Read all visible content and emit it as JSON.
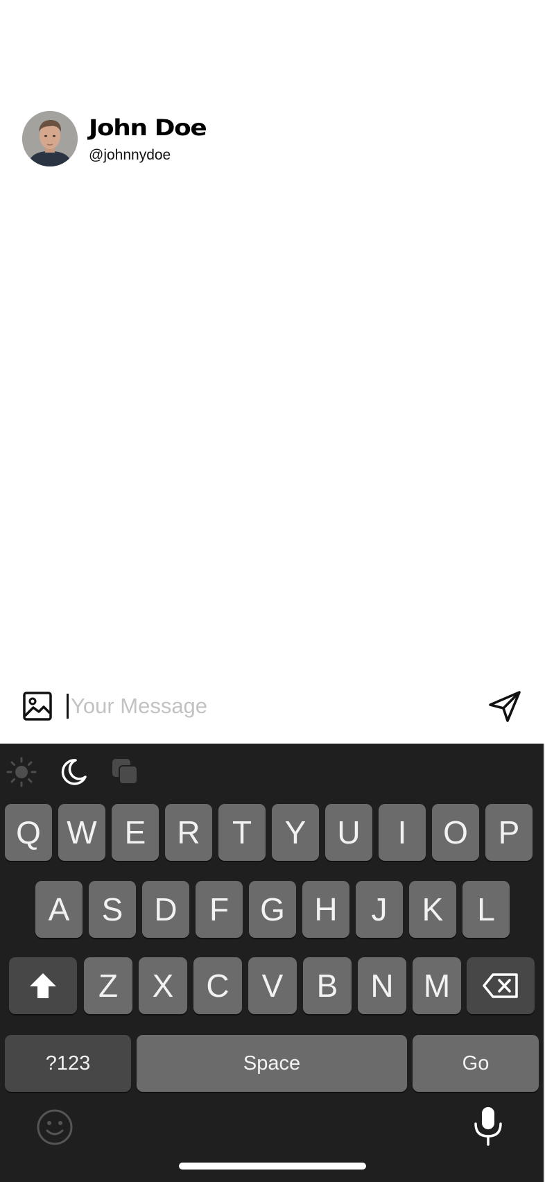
{
  "profile": {
    "name": "John Doe",
    "handle": "@johnnydoe"
  },
  "composer": {
    "placeholder": "Your Message",
    "value": ""
  },
  "keyboard": {
    "toolbar": [
      "sun-icon",
      "moon-icon",
      "stacked-squares-icon"
    ],
    "row1": [
      "Q",
      "W",
      "E",
      "R",
      "T",
      "Y",
      "U",
      "I",
      "O",
      "P"
    ],
    "row2": [
      "A",
      "S",
      "D",
      "F",
      "G",
      "H",
      "J",
      "K",
      "L"
    ],
    "row3": [
      "Z",
      "X",
      "C",
      "V",
      "B",
      "N",
      "M"
    ],
    "symbols_label": "?123",
    "space_label": "Space",
    "go_label": "Go"
  },
  "colors": {
    "keyboard_bg": "#1f1f1f",
    "key_bg": "#6b6b6b",
    "key_dark_bg": "#474747",
    "placeholder": "#c2c2c2"
  }
}
